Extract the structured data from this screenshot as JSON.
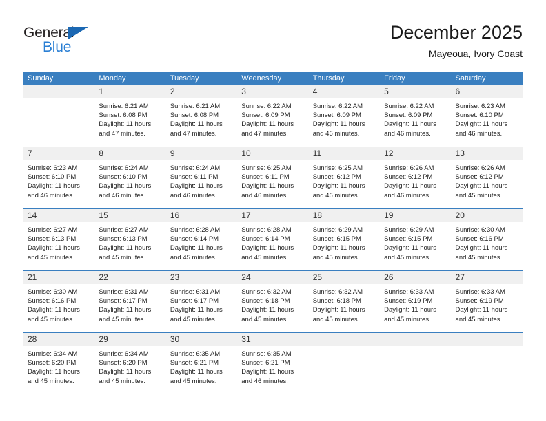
{
  "brand": {
    "word_one": "General",
    "word_two": "Blue",
    "triangle_color": "#1b68b3",
    "blue_text_color": "#2a7fd4",
    "logo_icon": "triangle-icon"
  },
  "header": {
    "title": "December 2025",
    "subtitle": "Mayeoua, Ivory Coast"
  },
  "theme": {
    "header_blue": "#3a7fc0",
    "day_band_gray": "#f0f0f0",
    "text_color": "#1f1f1f"
  },
  "weekdays": [
    "Sunday",
    "Monday",
    "Tuesday",
    "Wednesday",
    "Thursday",
    "Friday",
    "Saturday"
  ],
  "weeks": [
    [
      {
        "day": "",
        "lines": []
      },
      {
        "day": "1",
        "lines": [
          "Sunrise: 6:21 AM",
          "Sunset: 6:08 PM",
          "Daylight: 11 hours",
          "and 47 minutes."
        ]
      },
      {
        "day": "2",
        "lines": [
          "Sunrise: 6:21 AM",
          "Sunset: 6:08 PM",
          "Daylight: 11 hours",
          "and 47 minutes."
        ]
      },
      {
        "day": "3",
        "lines": [
          "Sunrise: 6:22 AM",
          "Sunset: 6:09 PM",
          "Daylight: 11 hours",
          "and 47 minutes."
        ]
      },
      {
        "day": "4",
        "lines": [
          "Sunrise: 6:22 AM",
          "Sunset: 6:09 PM",
          "Daylight: 11 hours",
          "and 46 minutes."
        ]
      },
      {
        "day": "5",
        "lines": [
          "Sunrise: 6:22 AM",
          "Sunset: 6:09 PM",
          "Daylight: 11 hours",
          "and 46 minutes."
        ]
      },
      {
        "day": "6",
        "lines": [
          "Sunrise: 6:23 AM",
          "Sunset: 6:10 PM",
          "Daylight: 11 hours",
          "and 46 minutes."
        ]
      }
    ],
    [
      {
        "day": "7",
        "lines": [
          "Sunrise: 6:23 AM",
          "Sunset: 6:10 PM",
          "Daylight: 11 hours",
          "and 46 minutes."
        ]
      },
      {
        "day": "8",
        "lines": [
          "Sunrise: 6:24 AM",
          "Sunset: 6:10 PM",
          "Daylight: 11 hours",
          "and 46 minutes."
        ]
      },
      {
        "day": "9",
        "lines": [
          "Sunrise: 6:24 AM",
          "Sunset: 6:11 PM",
          "Daylight: 11 hours",
          "and 46 minutes."
        ]
      },
      {
        "day": "10",
        "lines": [
          "Sunrise: 6:25 AM",
          "Sunset: 6:11 PM",
          "Daylight: 11 hours",
          "and 46 minutes."
        ]
      },
      {
        "day": "11",
        "lines": [
          "Sunrise: 6:25 AM",
          "Sunset: 6:12 PM",
          "Daylight: 11 hours",
          "and 46 minutes."
        ]
      },
      {
        "day": "12",
        "lines": [
          "Sunrise: 6:26 AM",
          "Sunset: 6:12 PM",
          "Daylight: 11 hours",
          "and 46 minutes."
        ]
      },
      {
        "day": "13",
        "lines": [
          "Sunrise: 6:26 AM",
          "Sunset: 6:12 PM",
          "Daylight: 11 hours",
          "and 45 minutes."
        ]
      }
    ],
    [
      {
        "day": "14",
        "lines": [
          "Sunrise: 6:27 AM",
          "Sunset: 6:13 PM",
          "Daylight: 11 hours",
          "and 45 minutes."
        ]
      },
      {
        "day": "15",
        "lines": [
          "Sunrise: 6:27 AM",
          "Sunset: 6:13 PM",
          "Daylight: 11 hours",
          "and 45 minutes."
        ]
      },
      {
        "day": "16",
        "lines": [
          "Sunrise: 6:28 AM",
          "Sunset: 6:14 PM",
          "Daylight: 11 hours",
          "and 45 minutes."
        ]
      },
      {
        "day": "17",
        "lines": [
          "Sunrise: 6:28 AM",
          "Sunset: 6:14 PM",
          "Daylight: 11 hours",
          "and 45 minutes."
        ]
      },
      {
        "day": "18",
        "lines": [
          "Sunrise: 6:29 AM",
          "Sunset: 6:15 PM",
          "Daylight: 11 hours",
          "and 45 minutes."
        ]
      },
      {
        "day": "19",
        "lines": [
          "Sunrise: 6:29 AM",
          "Sunset: 6:15 PM",
          "Daylight: 11 hours",
          "and 45 minutes."
        ]
      },
      {
        "day": "20",
        "lines": [
          "Sunrise: 6:30 AM",
          "Sunset: 6:16 PM",
          "Daylight: 11 hours",
          "and 45 minutes."
        ]
      }
    ],
    [
      {
        "day": "21",
        "lines": [
          "Sunrise: 6:30 AM",
          "Sunset: 6:16 PM",
          "Daylight: 11 hours",
          "and 45 minutes."
        ]
      },
      {
        "day": "22",
        "lines": [
          "Sunrise: 6:31 AM",
          "Sunset: 6:17 PM",
          "Daylight: 11 hours",
          "and 45 minutes."
        ]
      },
      {
        "day": "23",
        "lines": [
          "Sunrise: 6:31 AM",
          "Sunset: 6:17 PM",
          "Daylight: 11 hours",
          "and 45 minutes."
        ]
      },
      {
        "day": "24",
        "lines": [
          "Sunrise: 6:32 AM",
          "Sunset: 6:18 PM",
          "Daylight: 11 hours",
          "and 45 minutes."
        ]
      },
      {
        "day": "25",
        "lines": [
          "Sunrise: 6:32 AM",
          "Sunset: 6:18 PM",
          "Daylight: 11 hours",
          "and 45 minutes."
        ]
      },
      {
        "day": "26",
        "lines": [
          "Sunrise: 6:33 AM",
          "Sunset: 6:19 PM",
          "Daylight: 11 hours",
          "and 45 minutes."
        ]
      },
      {
        "day": "27",
        "lines": [
          "Sunrise: 6:33 AM",
          "Sunset: 6:19 PM",
          "Daylight: 11 hours",
          "and 45 minutes."
        ]
      }
    ],
    [
      {
        "day": "28",
        "lines": [
          "Sunrise: 6:34 AM",
          "Sunset: 6:20 PM",
          "Daylight: 11 hours",
          "and 45 minutes."
        ]
      },
      {
        "day": "29",
        "lines": [
          "Sunrise: 6:34 AM",
          "Sunset: 6:20 PM",
          "Daylight: 11 hours",
          "and 45 minutes."
        ]
      },
      {
        "day": "30",
        "lines": [
          "Sunrise: 6:35 AM",
          "Sunset: 6:21 PM",
          "Daylight: 11 hours",
          "and 45 minutes."
        ]
      },
      {
        "day": "31",
        "lines": [
          "Sunrise: 6:35 AM",
          "Sunset: 6:21 PM",
          "Daylight: 11 hours",
          "and 46 minutes."
        ]
      },
      {
        "day": "",
        "lines": []
      },
      {
        "day": "",
        "lines": []
      },
      {
        "day": "",
        "lines": []
      }
    ]
  ]
}
